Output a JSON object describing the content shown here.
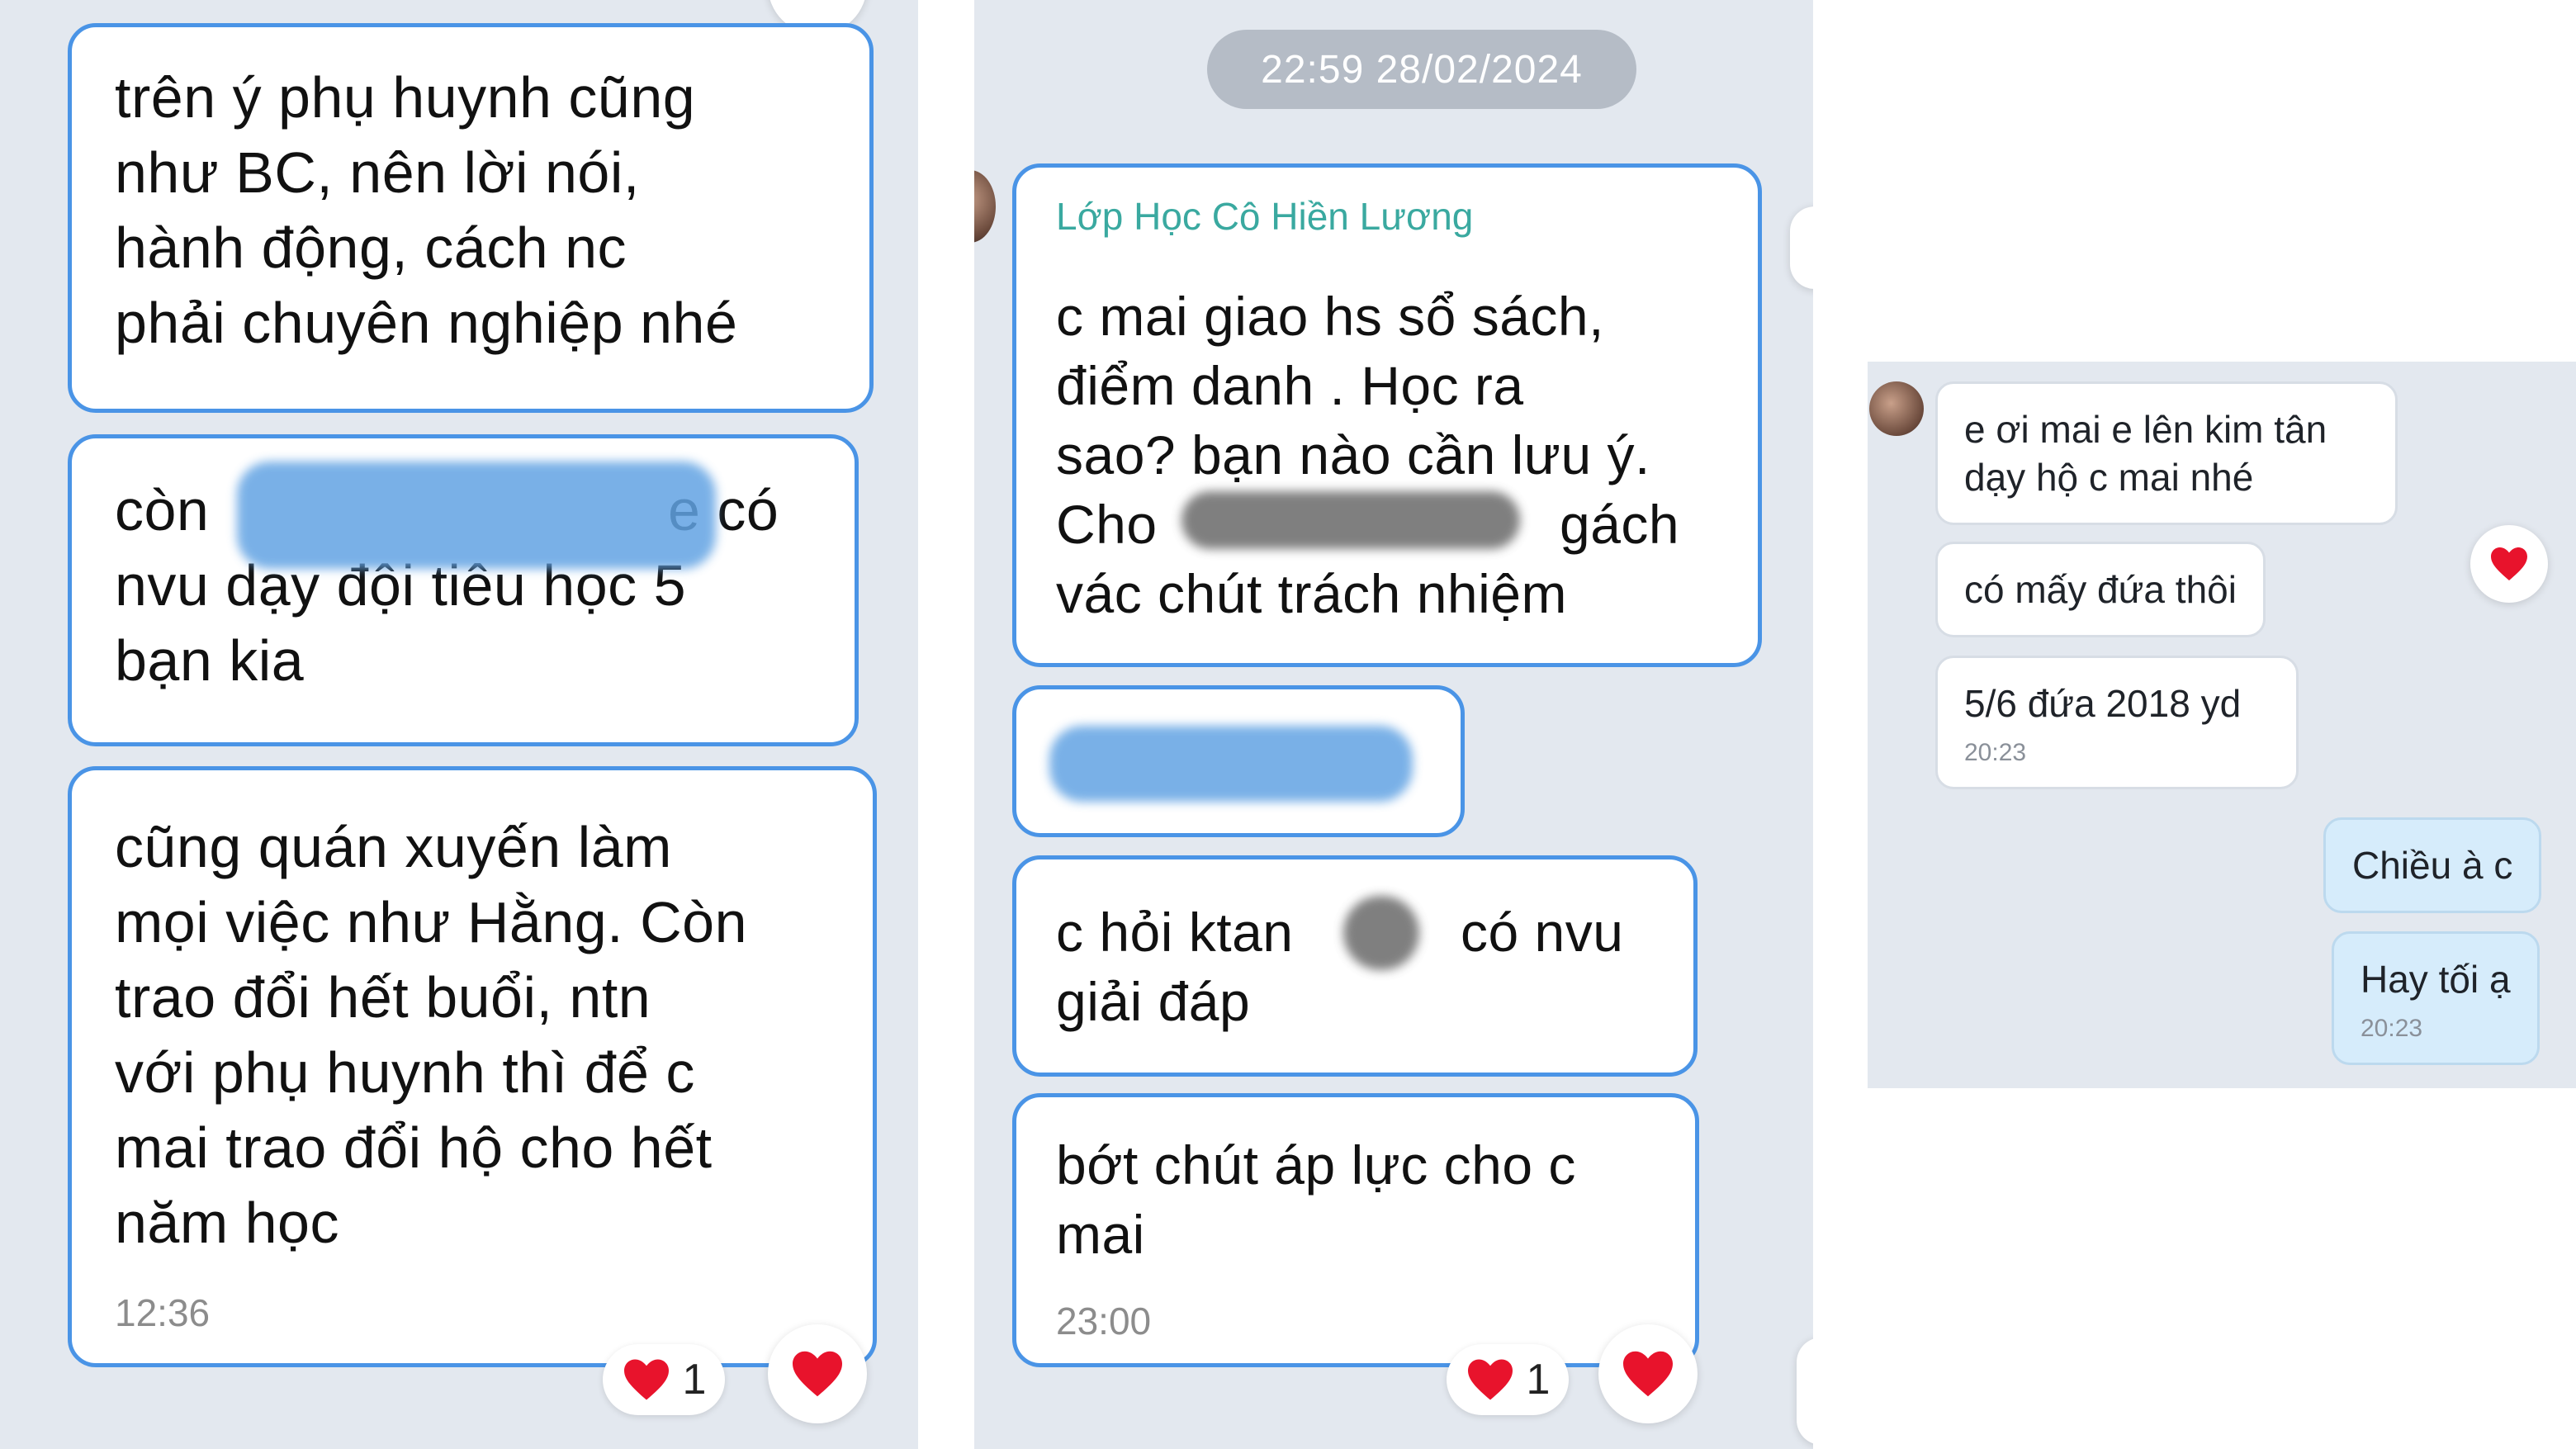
{
  "left_panel": {
    "messages": [
      {
        "text": "trên ý phụ huynh cũng\nnhư BC, nên lời nói,\nhành động, cách nc\nphải chuyên nghiệp nhé"
      },
      {
        "text_line1_start": "còn",
        "text_line1_end": "e có",
        "text_rest": "nvu dạy đội tiêu học 5\nbạn kia"
      },
      {
        "text": "cũng quán xuyến làm\nmọi việc như Hằng. Còn\ntrao đổi hết buổi, ntn\nvới phụ huynh thì để c\nmai trao đổi hộ cho hết\nnăm học",
        "time": "12:36"
      }
    ],
    "reaction_count": "1"
  },
  "middle_panel": {
    "date_pill": "22:59 28/02/2024",
    "sender_name": "Lớp Học Cô Hiền Lương",
    "messages": [
      {
        "text_lines_a": "c mai giao hs sổ sách,\nđiểm danh . Học ra\nsao?  bạn nào cần lưu ý.",
        "line4_start": "Cho",
        "line4_end": "gách",
        "line5": "vác chút trách nhiệm"
      },
      {
        "redacted": true
      },
      {
        "line1_start": "c hỏi ktan",
        "line1_end": "có nvu",
        "line2": "giải đáp"
      },
      {
        "text": "bớt chút áp lực cho c\nmai",
        "time": "23:00"
      }
    ],
    "reaction_count": "1"
  },
  "right_panel": {
    "incoming": [
      {
        "text": "e ơi mai e lên kim tân\ndạy hộ c mai nhé"
      },
      {
        "text": "có mấy đứa thôi"
      },
      {
        "text": "5/6 đứa 2018 yd",
        "time": "20:23"
      }
    ],
    "outgoing": [
      {
        "text": "Chiều à c"
      },
      {
        "text": "Hay tối ạ",
        "time": "20:23"
      }
    ]
  },
  "colors": {
    "chat_background": "#e3e8ef",
    "bubble_border": "#4a94e6",
    "sender_name": "#3aa9a0",
    "heart": "#e8132c",
    "outgoing_bubble": "#d6ecfb"
  },
  "icons": [
    "heart-icon",
    "avatar"
  ]
}
